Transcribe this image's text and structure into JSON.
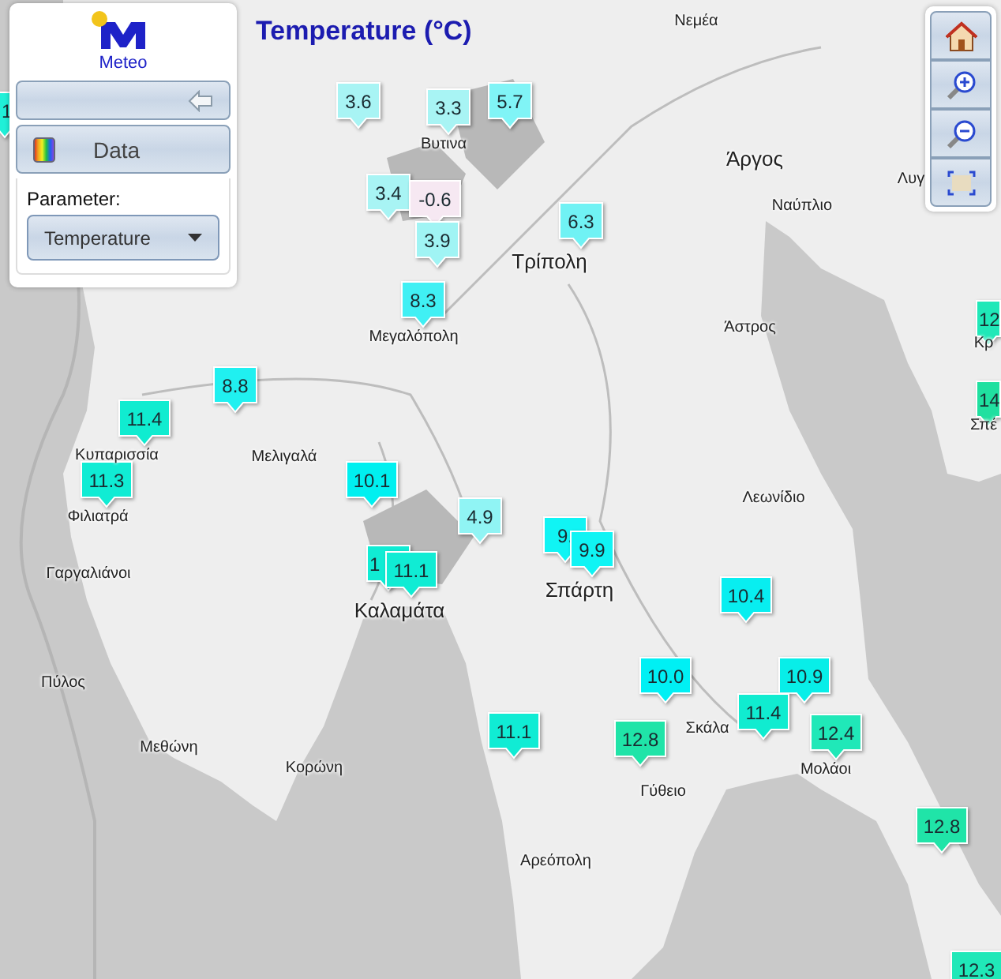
{
  "title": "Temperature (°C)",
  "panel": {
    "logo_text": "Meteo",
    "data_button": "Data",
    "parameter_label": "Parameter:",
    "parameter_select": {
      "value": "Temperature"
    }
  },
  "places": [
    {
      "name": "Νεμέα",
      "kind": "town"
    },
    {
      "name": "Βυτινα",
      "kind": "town"
    },
    {
      "name": "Άργος",
      "kind": "city"
    },
    {
      "name": "Ναύπλιο",
      "kind": "town"
    },
    {
      "name": "Λυγ",
      "kind": "town"
    },
    {
      "name": "Τρίπολη",
      "kind": "city"
    },
    {
      "name": "Μεγαλόπολη",
      "kind": "town"
    },
    {
      "name": "Άστρος",
      "kind": "town"
    },
    {
      "name": "Κρ",
      "kind": "town"
    },
    {
      "name": "Σπέ",
      "kind": "town"
    },
    {
      "name": "Κυπαρισσία",
      "kind": "town"
    },
    {
      "name": "Μελιγαλά",
      "kind": "town"
    },
    {
      "name": "Φιλιατρά",
      "kind": "town"
    },
    {
      "name": "Λεωνίδιο",
      "kind": "town"
    },
    {
      "name": "Γαργαλιάνοι",
      "kind": "town"
    },
    {
      "name": "Σπάρτη",
      "kind": "city"
    },
    {
      "name": "Καλαμάτα",
      "kind": "city"
    },
    {
      "name": "Πύλος",
      "kind": "town"
    },
    {
      "name": "Σκάλα",
      "kind": "town"
    },
    {
      "name": "Μεθώνη",
      "kind": "town"
    },
    {
      "name": "Μολάοι",
      "kind": "town"
    },
    {
      "name": "Κορώνη",
      "kind": "town"
    },
    {
      "name": "Γύθειο",
      "kind": "town"
    },
    {
      "name": "Αρεόπολη",
      "kind": "town"
    }
  ],
  "markers": [
    {
      "value": "1",
      "color": "#20f0d8"
    },
    {
      "value": "3.6",
      "color": "#a8f4f4"
    },
    {
      "value": "3.3",
      "color": "#a8f4f4"
    },
    {
      "value": "5.7",
      "color": "#80f4f6"
    },
    {
      "value": "3.4",
      "color": "#a8f4f4"
    },
    {
      "value": "-0.6",
      "color": "#f6e8f2"
    },
    {
      "value": "3.9",
      "color": "#a0f4f4"
    },
    {
      "value": "6.3",
      "color": "#70f2f4"
    },
    {
      "value": "8.3",
      "color": "#40f0f4"
    },
    {
      "value": "12",
      "color": "#20e8b8"
    },
    {
      "value": "14",
      "color": "#20e0a0"
    },
    {
      "value": "8.8",
      "color": "#20f0f0"
    },
    {
      "value": "11.4",
      "color": "#10ecd0"
    },
    {
      "value": "11.3",
      "color": "#10ecd4"
    },
    {
      "value": "10.1",
      "color": "#00f0f0"
    },
    {
      "value": "4.9",
      "color": "#90f4f4"
    },
    {
      "value": "9.",
      "color": "#10f4f4"
    },
    {
      "value": "9.9",
      "color": "#10f4f4"
    },
    {
      "value": "1",
      "color": "#10ecd4"
    },
    {
      "value": "11.1",
      "color": "#10ecd4"
    },
    {
      "value": "10.4",
      "color": "#08eef0"
    },
    {
      "value": "10.0",
      "color": "#00f0f4"
    },
    {
      "value": "10.9",
      "color": "#08eee8"
    },
    {
      "value": "11.4",
      "color": "#10ecd0"
    },
    {
      "value": "11.1",
      "color": "#10ecd4"
    },
    {
      "value": "12.8",
      "color": "#20e4a8"
    },
    {
      "value": "12.4",
      "color": "#20e8b8"
    },
    {
      "value": "12.8",
      "color": "#20e4a8"
    },
    {
      "value": "12.3",
      "color": "#20e8b8"
    }
  ]
}
